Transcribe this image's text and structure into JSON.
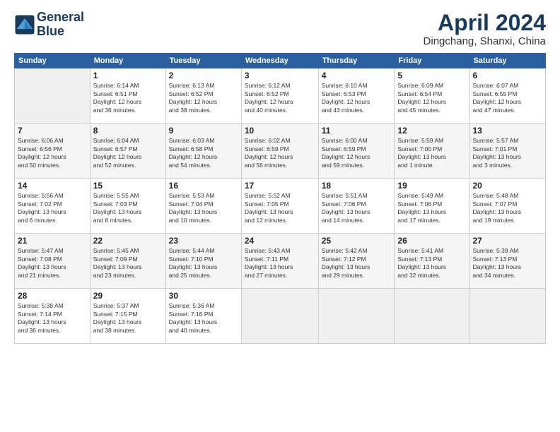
{
  "header": {
    "logo_line1": "General",
    "logo_line2": "Blue",
    "month": "April 2024",
    "location": "Dingchang, Shanxi, China"
  },
  "weekdays": [
    "Sunday",
    "Monday",
    "Tuesday",
    "Wednesday",
    "Thursday",
    "Friday",
    "Saturday"
  ],
  "weeks": [
    [
      {
        "day": "",
        "info": ""
      },
      {
        "day": "1",
        "info": "Sunrise: 6:14 AM\nSunset: 6:51 PM\nDaylight: 12 hours\nand 36 minutes."
      },
      {
        "day": "2",
        "info": "Sunrise: 6:13 AM\nSunset: 6:52 PM\nDaylight: 12 hours\nand 38 minutes."
      },
      {
        "day": "3",
        "info": "Sunrise: 6:12 AM\nSunset: 6:52 PM\nDaylight: 12 hours\nand 40 minutes."
      },
      {
        "day": "4",
        "info": "Sunrise: 6:10 AM\nSunset: 6:53 PM\nDaylight: 12 hours\nand 43 minutes."
      },
      {
        "day": "5",
        "info": "Sunrise: 6:09 AM\nSunset: 6:54 PM\nDaylight: 12 hours\nand 45 minutes."
      },
      {
        "day": "6",
        "info": "Sunrise: 6:07 AM\nSunset: 6:55 PM\nDaylight: 12 hours\nand 47 minutes."
      }
    ],
    [
      {
        "day": "7",
        "info": "Sunrise: 6:06 AM\nSunset: 6:56 PM\nDaylight: 12 hours\nand 50 minutes."
      },
      {
        "day": "8",
        "info": "Sunrise: 6:04 AM\nSunset: 6:57 PM\nDaylight: 12 hours\nand 52 minutes."
      },
      {
        "day": "9",
        "info": "Sunrise: 6:03 AM\nSunset: 6:58 PM\nDaylight: 12 hours\nand 54 minutes."
      },
      {
        "day": "10",
        "info": "Sunrise: 6:02 AM\nSunset: 6:59 PM\nDaylight: 12 hours\nand 56 minutes."
      },
      {
        "day": "11",
        "info": "Sunrise: 6:00 AM\nSunset: 6:59 PM\nDaylight: 12 hours\nand 59 minutes."
      },
      {
        "day": "12",
        "info": "Sunrise: 5:59 AM\nSunset: 7:00 PM\nDaylight: 13 hours\nand 1 minute."
      },
      {
        "day": "13",
        "info": "Sunrise: 5:57 AM\nSunset: 7:01 PM\nDaylight: 13 hours\nand 3 minutes."
      }
    ],
    [
      {
        "day": "14",
        "info": "Sunrise: 5:56 AM\nSunset: 7:02 PM\nDaylight: 13 hours\nand 6 minutes."
      },
      {
        "day": "15",
        "info": "Sunrise: 5:55 AM\nSunset: 7:03 PM\nDaylight: 13 hours\nand 8 minutes."
      },
      {
        "day": "16",
        "info": "Sunrise: 5:53 AM\nSunset: 7:04 PM\nDaylight: 13 hours\nand 10 minutes."
      },
      {
        "day": "17",
        "info": "Sunrise: 5:52 AM\nSunset: 7:05 PM\nDaylight: 13 hours\nand 12 minutes."
      },
      {
        "day": "18",
        "info": "Sunrise: 5:51 AM\nSunset: 7:06 PM\nDaylight: 13 hours\nand 14 minutes."
      },
      {
        "day": "19",
        "info": "Sunrise: 5:49 AM\nSunset: 7:06 PM\nDaylight: 13 hours\nand 17 minutes."
      },
      {
        "day": "20",
        "info": "Sunrise: 5:48 AM\nSunset: 7:07 PM\nDaylight: 13 hours\nand 19 minutes."
      }
    ],
    [
      {
        "day": "21",
        "info": "Sunrise: 5:47 AM\nSunset: 7:08 PM\nDaylight: 13 hours\nand 21 minutes."
      },
      {
        "day": "22",
        "info": "Sunrise: 5:45 AM\nSunset: 7:09 PM\nDaylight: 13 hours\nand 23 minutes."
      },
      {
        "day": "23",
        "info": "Sunrise: 5:44 AM\nSunset: 7:10 PM\nDaylight: 13 hours\nand 25 minutes."
      },
      {
        "day": "24",
        "info": "Sunrise: 5:43 AM\nSunset: 7:11 PM\nDaylight: 13 hours\nand 27 minutes."
      },
      {
        "day": "25",
        "info": "Sunrise: 5:42 AM\nSunset: 7:12 PM\nDaylight: 13 hours\nand 29 minutes."
      },
      {
        "day": "26",
        "info": "Sunrise: 5:41 AM\nSunset: 7:13 PM\nDaylight: 13 hours\nand 32 minutes."
      },
      {
        "day": "27",
        "info": "Sunrise: 5:39 AM\nSunset: 7:13 PM\nDaylight: 13 hours\nand 34 minutes."
      }
    ],
    [
      {
        "day": "28",
        "info": "Sunrise: 5:38 AM\nSunset: 7:14 PM\nDaylight: 13 hours\nand 36 minutes."
      },
      {
        "day": "29",
        "info": "Sunrise: 5:37 AM\nSunset: 7:15 PM\nDaylight: 13 hours\nand 38 minutes."
      },
      {
        "day": "30",
        "info": "Sunrise: 5:36 AM\nSunset: 7:16 PM\nDaylight: 13 hours\nand 40 minutes."
      },
      {
        "day": "",
        "info": ""
      },
      {
        "day": "",
        "info": ""
      },
      {
        "day": "",
        "info": ""
      },
      {
        "day": "",
        "info": ""
      }
    ]
  ]
}
